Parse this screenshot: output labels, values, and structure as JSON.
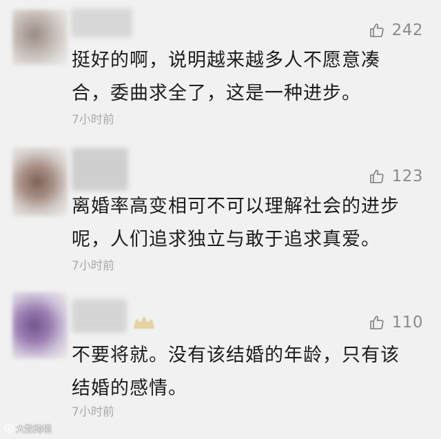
{
  "comments": [
    {
      "likes": "242",
      "text_lines": [
        "挺好的啊，说明越来越多人不愿意凑",
        "合，委曲求全了，这是一种进步。"
      ],
      "time": "7小时前"
    },
    {
      "likes": "123",
      "text_lines": [
        "离婚率高变相可不可以理解社会的进步",
        "呢，人们追求独立与敢于追求真爱。"
      ],
      "time": "7小时前"
    },
    {
      "likes": "110",
      "text_lines": [
        "不要将就。没有该结婚的年龄，只有该",
        "结婚的感情。"
      ],
      "time": "7小时前"
    }
  ],
  "icons": {
    "like": "thumbs-up-icon"
  },
  "watermark": "大数跨境",
  "colors": {
    "background": "#f1f1f1",
    "text": "#1c1c1c",
    "meta": "#a9a9a9",
    "like": "#8a8a8a"
  }
}
